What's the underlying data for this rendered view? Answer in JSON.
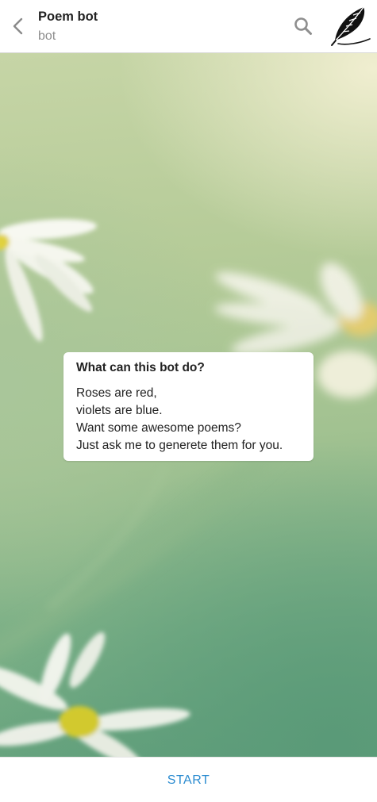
{
  "header": {
    "back_icon": "chevron-left-icon",
    "title": "Poem bot",
    "subtitle": "bot",
    "search_icon": "search-icon",
    "avatar_icon": "feather-quill-icon"
  },
  "info_card": {
    "title": "What can this bot do?",
    "lines": [
      "Roses are red,",
      "violets are blue.",
      "Want some awesome poems?",
      "Just ask me to generete them for you."
    ]
  },
  "bottom_bar": {
    "start_label": "START"
  },
  "colors": {
    "accent": "#2a8bd0",
    "header_bg": "#ffffff",
    "title_text": "#222222",
    "subtitle_text": "#8e8e8e"
  }
}
